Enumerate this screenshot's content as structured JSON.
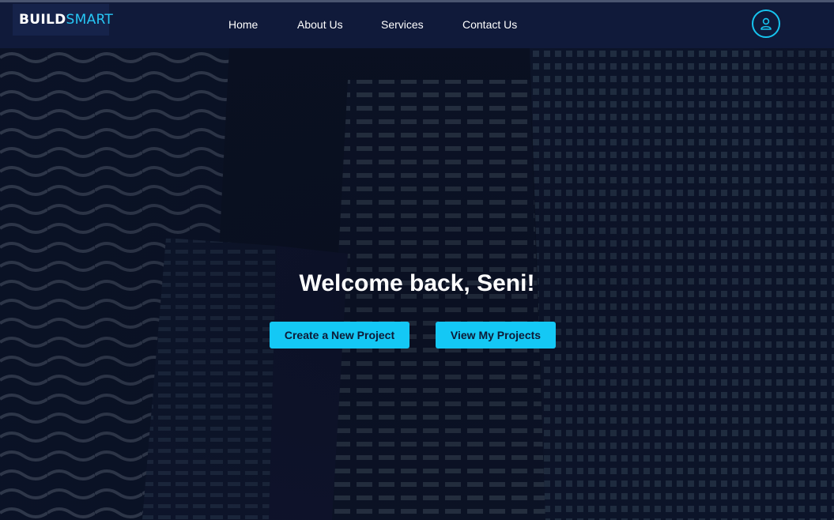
{
  "header": {
    "logo_part1": "BUILD",
    "logo_part2": "SMART",
    "nav": [
      "Home",
      "About Us",
      "Services",
      "Contact Us"
    ],
    "profile_icon": "user-icon"
  },
  "hero": {
    "welcome": "Welcome back, Seni!",
    "primary_cta": "Create a New Project",
    "secondary_cta": "View My Projects",
    "background": "night-skyscrapers-photo"
  },
  "colors": {
    "accent": "#14c8f5",
    "navbar": "#101a3a",
    "logo_bg": "#16234a"
  }
}
